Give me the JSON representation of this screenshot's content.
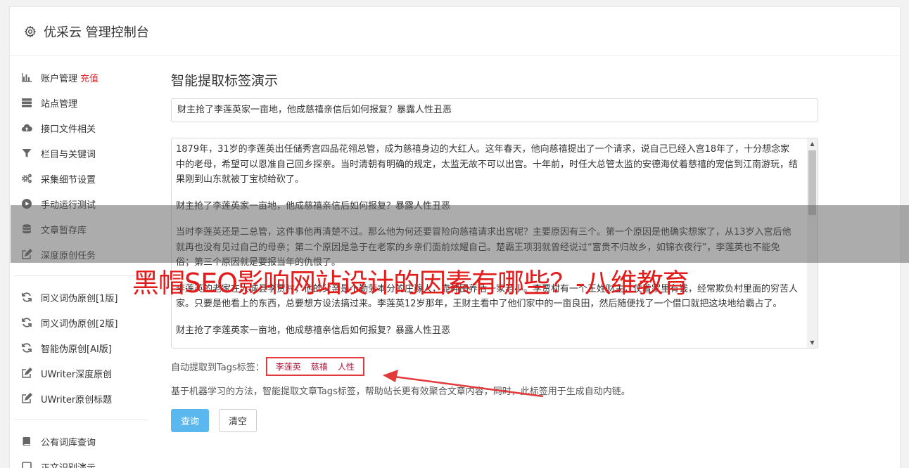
{
  "header": {
    "title": "优采云 管理控制台"
  },
  "sidebar": {
    "group1": [
      {
        "label": "账户管理",
        "badge": "充值",
        "icon": "bar-chart-icon"
      },
      {
        "label": "站点管理",
        "icon": "server-icon"
      },
      {
        "label": "接口文件相关",
        "icon": "cloud-upload-icon"
      },
      {
        "label": "栏目与关键词",
        "icon": "filter-icon"
      },
      {
        "label": "采集细节设置",
        "icon": "cogs-icon"
      },
      {
        "label": "手动运行测试",
        "icon": "play-circle-icon"
      },
      {
        "label": "文章暂存库",
        "icon": "database-icon"
      },
      {
        "label": "深度原创任务",
        "icon": "edit-icon"
      }
    ],
    "group2": [
      {
        "label": "同义词伪原创[1版]",
        "icon": "refresh-icon"
      },
      {
        "label": "同义词伪原创[2版]",
        "icon": "refresh-icon"
      },
      {
        "label": "智能伪原创[AI版]",
        "icon": "refresh-icon"
      },
      {
        "label": "UWriter深度原创",
        "icon": "edit-icon"
      },
      {
        "label": "UWriter原创标题",
        "icon": "edit-icon"
      }
    ],
    "group3": [
      {
        "label": "公有词库查询",
        "icon": "book-icon"
      },
      {
        "label": "正文识别演示",
        "icon": "square-icon"
      }
    ]
  },
  "main": {
    "title": "智能提取标签演示",
    "title_input_value": "财主抢了李莲英家一亩地，他成慈禧亲信后如何报复？暴露人性丑恶",
    "content_paragraphs": [
      "1879年，31岁的李莲英出任储秀宫四品花翎总管，成为慈禧身边的大红人。这年春天，他向慈禧提出了一个请求，说自己已经入宫18年了，十分想念家中的老母，希望可以恩准自己回乡探亲。当时清朝有明确的规定，太监无故不可以出宫。十年前，时任大总管太监的安德海仗着慈禧的宠信到江南游玩，结果刚到山东就被丁宝桢给砍了。",
      "财主抢了李莲英家一亩地，他成慈禧亲信后如何报复？暴露人性丑恶",
      "当时李莲英还是二总管，这件事他再清楚不过。那么他为何还要冒险向慈禧请求出宫呢？主要原因有三个。第一个原因是他确实想家了，从13岁入宫后他就再也没有见过自己的母亲；第二个原因是急于在老家的乡亲们面前炫耀自己。楚霸王项羽就曾经说过“富贵不归故乡，如锦衣夜行”，李莲英也不能免俗；第三个原因就是要报当年的仇恨了。",
      "李莲英的老家在大城县李贾村，他的父亲是个勤劳本分的庄稼人，靠种田养活一家老小。李贾村有一个王姓财主，仗着家里有钱，经常欺负村里面的穷苦人家。只要是他看上的东西，总要想方设法搞过来。李莲英12岁那年，王财主看中了他们家中的一亩良田，然后随便找了一个借口就把这块地给霸占了。",
      "财主抢了李莲英家一亩地，他成慈禧亲信后如何报复？暴露人性丑恶"
    ],
    "tags_label": "自动提取到Tags标签：",
    "tags": [
      "李莲英",
      "慈禧",
      "人性"
    ],
    "description": "基于机器学习的方法，智能提取文章Tags标签，帮助站长更有效聚合文章内容，同时，此标签用于生成自动内链。",
    "query_button": "查询",
    "clear_button": "清空"
  },
  "overlay": {
    "text": "黑帽SEO影响网站设计的因素有哪些？-八维教育"
  },
  "colors": {
    "primary": "#5bb8ef",
    "accent_red": "#e21b1b",
    "tag": "#b3123a"
  }
}
